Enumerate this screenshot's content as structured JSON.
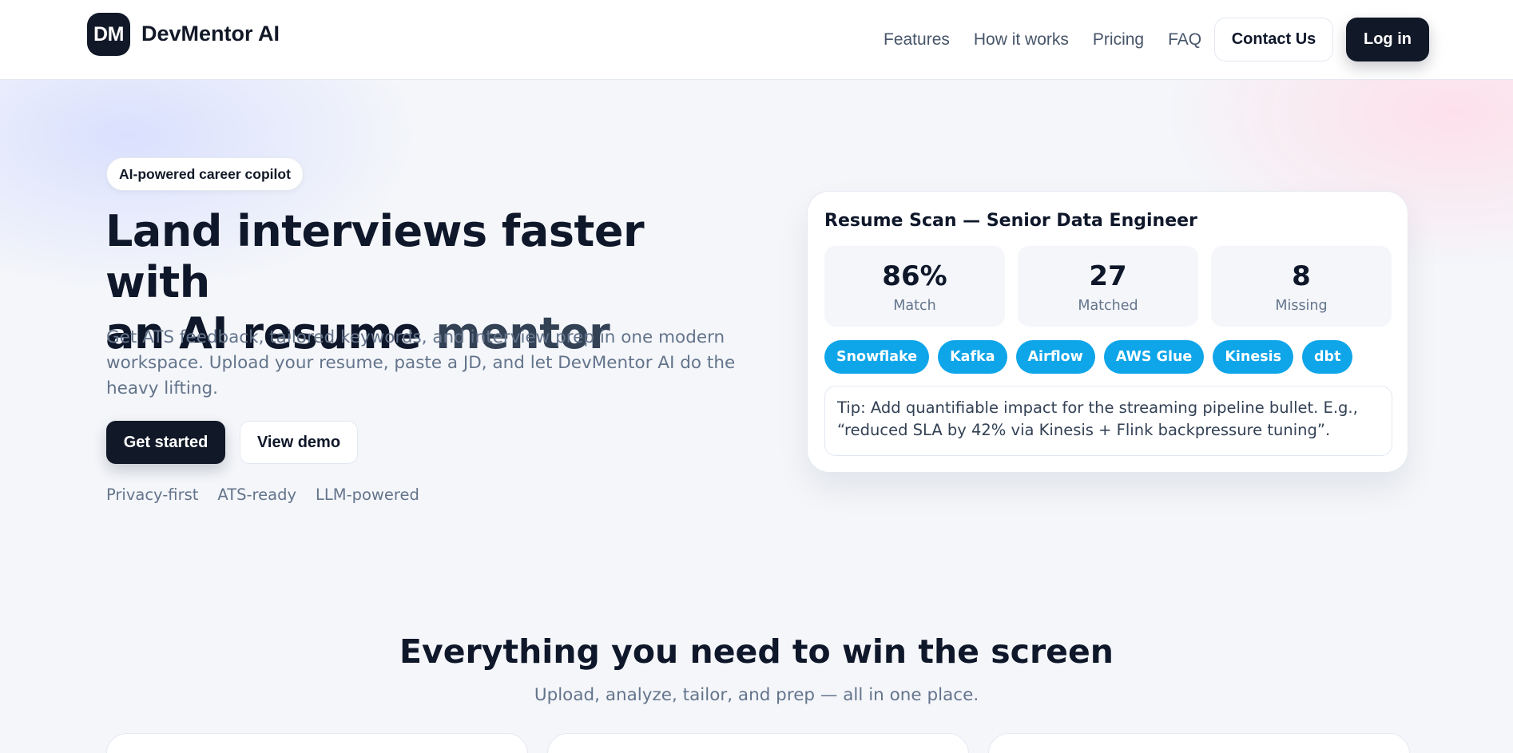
{
  "brand": {
    "logo_text": "DM",
    "name": "DevMentor AI"
  },
  "nav": {
    "links": [
      "Features",
      "How it works",
      "Pricing",
      "FAQ"
    ],
    "contact_label": "Contact Us",
    "login_label": "Log in"
  },
  "hero": {
    "pill": "AI-powered career copilot",
    "title_line1": "Land interviews faster with",
    "title_line2_a": "an AI resume ",
    "title_line2_b": "mentor",
    "subtitle": "Get ATS feedback, tailored keywords, and interview prep in one modern workspace. Upload your resume, paste a JD, and let DevMentor AI do the heavy lifting.",
    "primary_cta": "Get started",
    "secondary_cta": "View demo",
    "badges": [
      "Privacy-first",
      "ATS-ready",
      "LLM-powered"
    ]
  },
  "scan_card": {
    "title": "Resume Scan — Senior Data Engineer",
    "stats": [
      {
        "value": "86%",
        "label": "Match"
      },
      {
        "value": "27",
        "label": "Matched"
      },
      {
        "value": "8",
        "label": "Missing"
      }
    ],
    "keywords": [
      "Snowflake",
      "Kafka",
      "Airflow",
      "AWS Glue",
      "Kinesis",
      "dbt"
    ],
    "tip": "Tip: Add quantifiable impact for the streaming pipeline bullet. E.g., “reduced SLA by 42% via Kinesis + Flink backpressure tuning”."
  },
  "features": {
    "title": "Everything you need to win the screen",
    "subtitle": "Upload, analyze, tailor, and prep — all in one place."
  },
  "colors": {
    "primary": "#111827",
    "tag": "#0ea5e9",
    "muted_text": "#64748b",
    "background": "#f4f6fa"
  }
}
